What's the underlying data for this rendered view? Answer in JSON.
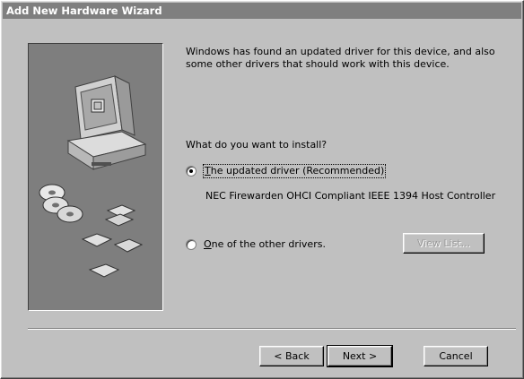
{
  "window": {
    "title": "Add New Hardware Wizard"
  },
  "intro": {
    "text": "Windows has found an updated driver for this device, and also some other drivers that should work with this device."
  },
  "question": {
    "text": "What do you want to install?"
  },
  "options": [
    {
      "label": "The updated driver (Recommended)",
      "checked": true,
      "description": "NEC Firewarden OHCI Compliant IEEE 1394 Host Controller"
    },
    {
      "label": "One of the other drivers.",
      "checked": false
    }
  ],
  "buttons": {
    "view_list": "View List...",
    "back": "< Back",
    "next": "Next >",
    "cancel": "Cancel"
  },
  "icons": [
    "computer-icon",
    "cd-disc-icon",
    "floppy-disk-icon"
  ]
}
